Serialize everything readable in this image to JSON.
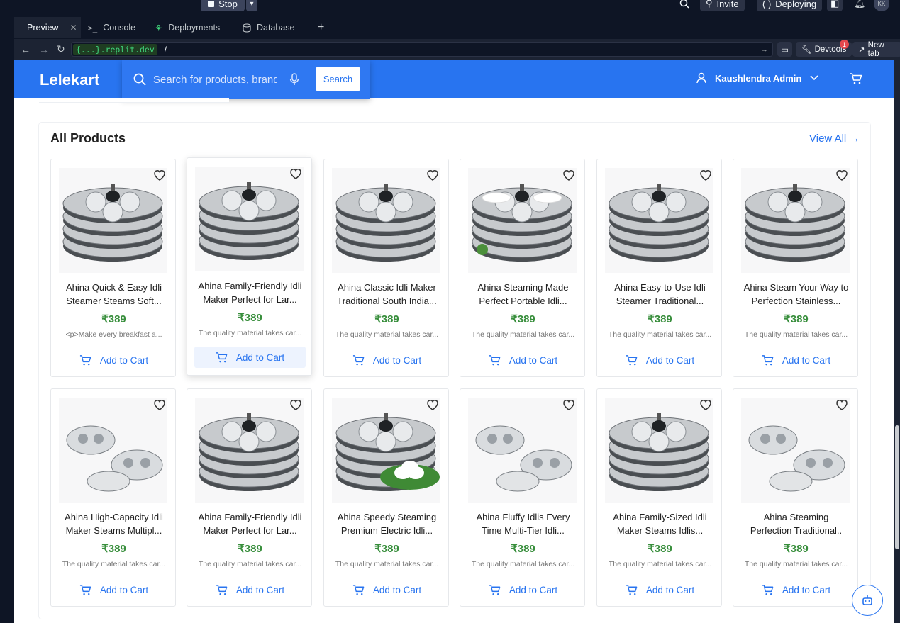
{
  "ide": {
    "stop_label": "Stop",
    "invite_label": "Invite",
    "deploying_label": "Deploying",
    "avatar_initials": "KK",
    "tabs": [
      {
        "label": "Preview"
      },
      {
        "label": "Console"
      },
      {
        "label": "Deployments"
      },
      {
        "label": "Database"
      }
    ],
    "url_host": "{...}.replit.dev",
    "url_path": "/",
    "devtools_label": "Devtools",
    "devtools_badge": "1",
    "newtab_label": "New tab"
  },
  "site": {
    "logo": "Lelekart",
    "search_placeholder": "Search for products, brands and more",
    "search_button": "Search",
    "user_name": "Kaushlendra Admin",
    "brand_color": "#2874f0"
  },
  "section": {
    "title": "All Products",
    "view_all": "View All →"
  },
  "add_to_cart_label": "Add to Cart",
  "products": [
    {
      "line1": "Ahina Quick & Easy Idli",
      "line2": "Steamer  Steams Soft...",
      "price": "₹389",
      "desc": "<p>Make every breakfast a..."
    },
    {
      "line1": "Ahina Family-Friendly Idli",
      "line2": "Maker  Perfect for Lar...",
      "price": "₹389",
      "desc": "The quality material takes car..."
    },
    {
      "line1": "Ahina Classic Idli Maker ",
      "line2": "Traditional South India...",
      "price": "₹389",
      "desc": "The quality material takes car..."
    },
    {
      "line1": "Ahina Steaming Made",
      "line2": "Perfect  Portable Idli...",
      "price": "₹389",
      "desc": "The quality material takes car..."
    },
    {
      "line1": "Ahina Easy-to-Use Idli",
      "line2": "Steamer  Traditional...",
      "price": "₹389",
      "desc": "The quality material takes car..."
    },
    {
      "line1": "Ahina Steam Your Way to",
      "line2": "Perfection  Stainless...",
      "price": "₹389",
      "desc": "The quality material takes car..."
    },
    {
      "line1": "Ahina High-Capacity Idli",
      "line2": "Maker  Steams Multipl...",
      "price": "₹389",
      "desc": "The quality material takes car..."
    },
    {
      "line1": "Ahina Family-Friendly Idli",
      "line2": "Maker  Perfect for Lar...",
      "price": "₹389",
      "desc": "The quality material takes car..."
    },
    {
      "line1": "Ahina Speedy Steaming",
      "line2": " Premium Electric Idli...",
      "price": "₹389",
      "desc": "The quality material takes car..."
    },
    {
      "line1": "Ahina Fluffy Idlis Every",
      "line2": "Time  Multi-Tier Idli...",
      "price": "₹389",
      "desc": "The quality material takes car..."
    },
    {
      "line1": "Ahina Family-Sized Idli",
      "line2": "Maker  Steams Idlis...",
      "price": "₹389",
      "desc": "The quality material takes car..."
    },
    {
      "line1": "Ahina Steaming",
      "line2": "Perfection  Traditional..",
      "price": "₹389",
      "desc": "The quality material takes car..."
    }
  ]
}
